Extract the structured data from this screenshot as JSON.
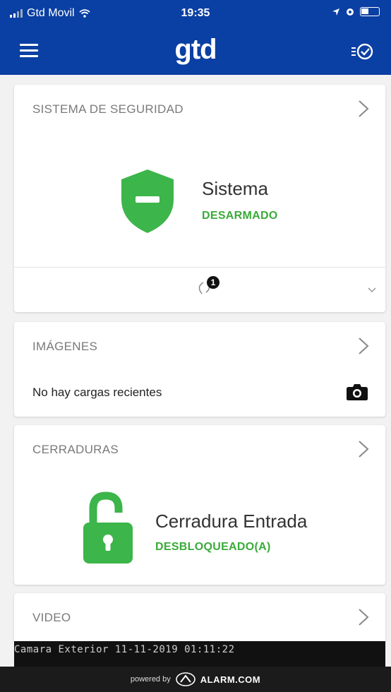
{
  "status_bar": {
    "carrier": "Gtd Movil",
    "time": "19:35"
  },
  "app_bar": {
    "logo": "gtd"
  },
  "security": {
    "title": "SISTEMA DE SEGURIDAD",
    "label": "Sistema",
    "state": "DESARMADO",
    "badge": "1"
  },
  "images": {
    "title": "IMÁGENES",
    "empty_text": "No hay cargas recientes"
  },
  "locks": {
    "title": "CERRADURAS",
    "label": "Cerradura Entrada",
    "state": "DESBLOQUEADO(A)"
  },
  "video": {
    "title": "VIDEO",
    "overlay": "Camara Exterior  11-11-2019 01:11:22"
  },
  "footer": {
    "powered": "powered by",
    "brand": "ALARM.COM"
  },
  "colors": {
    "primary": "#0a3fa3",
    "status_green": "#3aab3a",
    "shield_green": "#3cb54a"
  },
  "icons": [
    "menu-icon",
    "tasks-icon",
    "chevron-right-icon",
    "shield-icon",
    "camera-icon",
    "padlock-open-icon",
    "sync-icon",
    "chevron-down-icon",
    "wifi-icon",
    "battery-icon"
  ]
}
